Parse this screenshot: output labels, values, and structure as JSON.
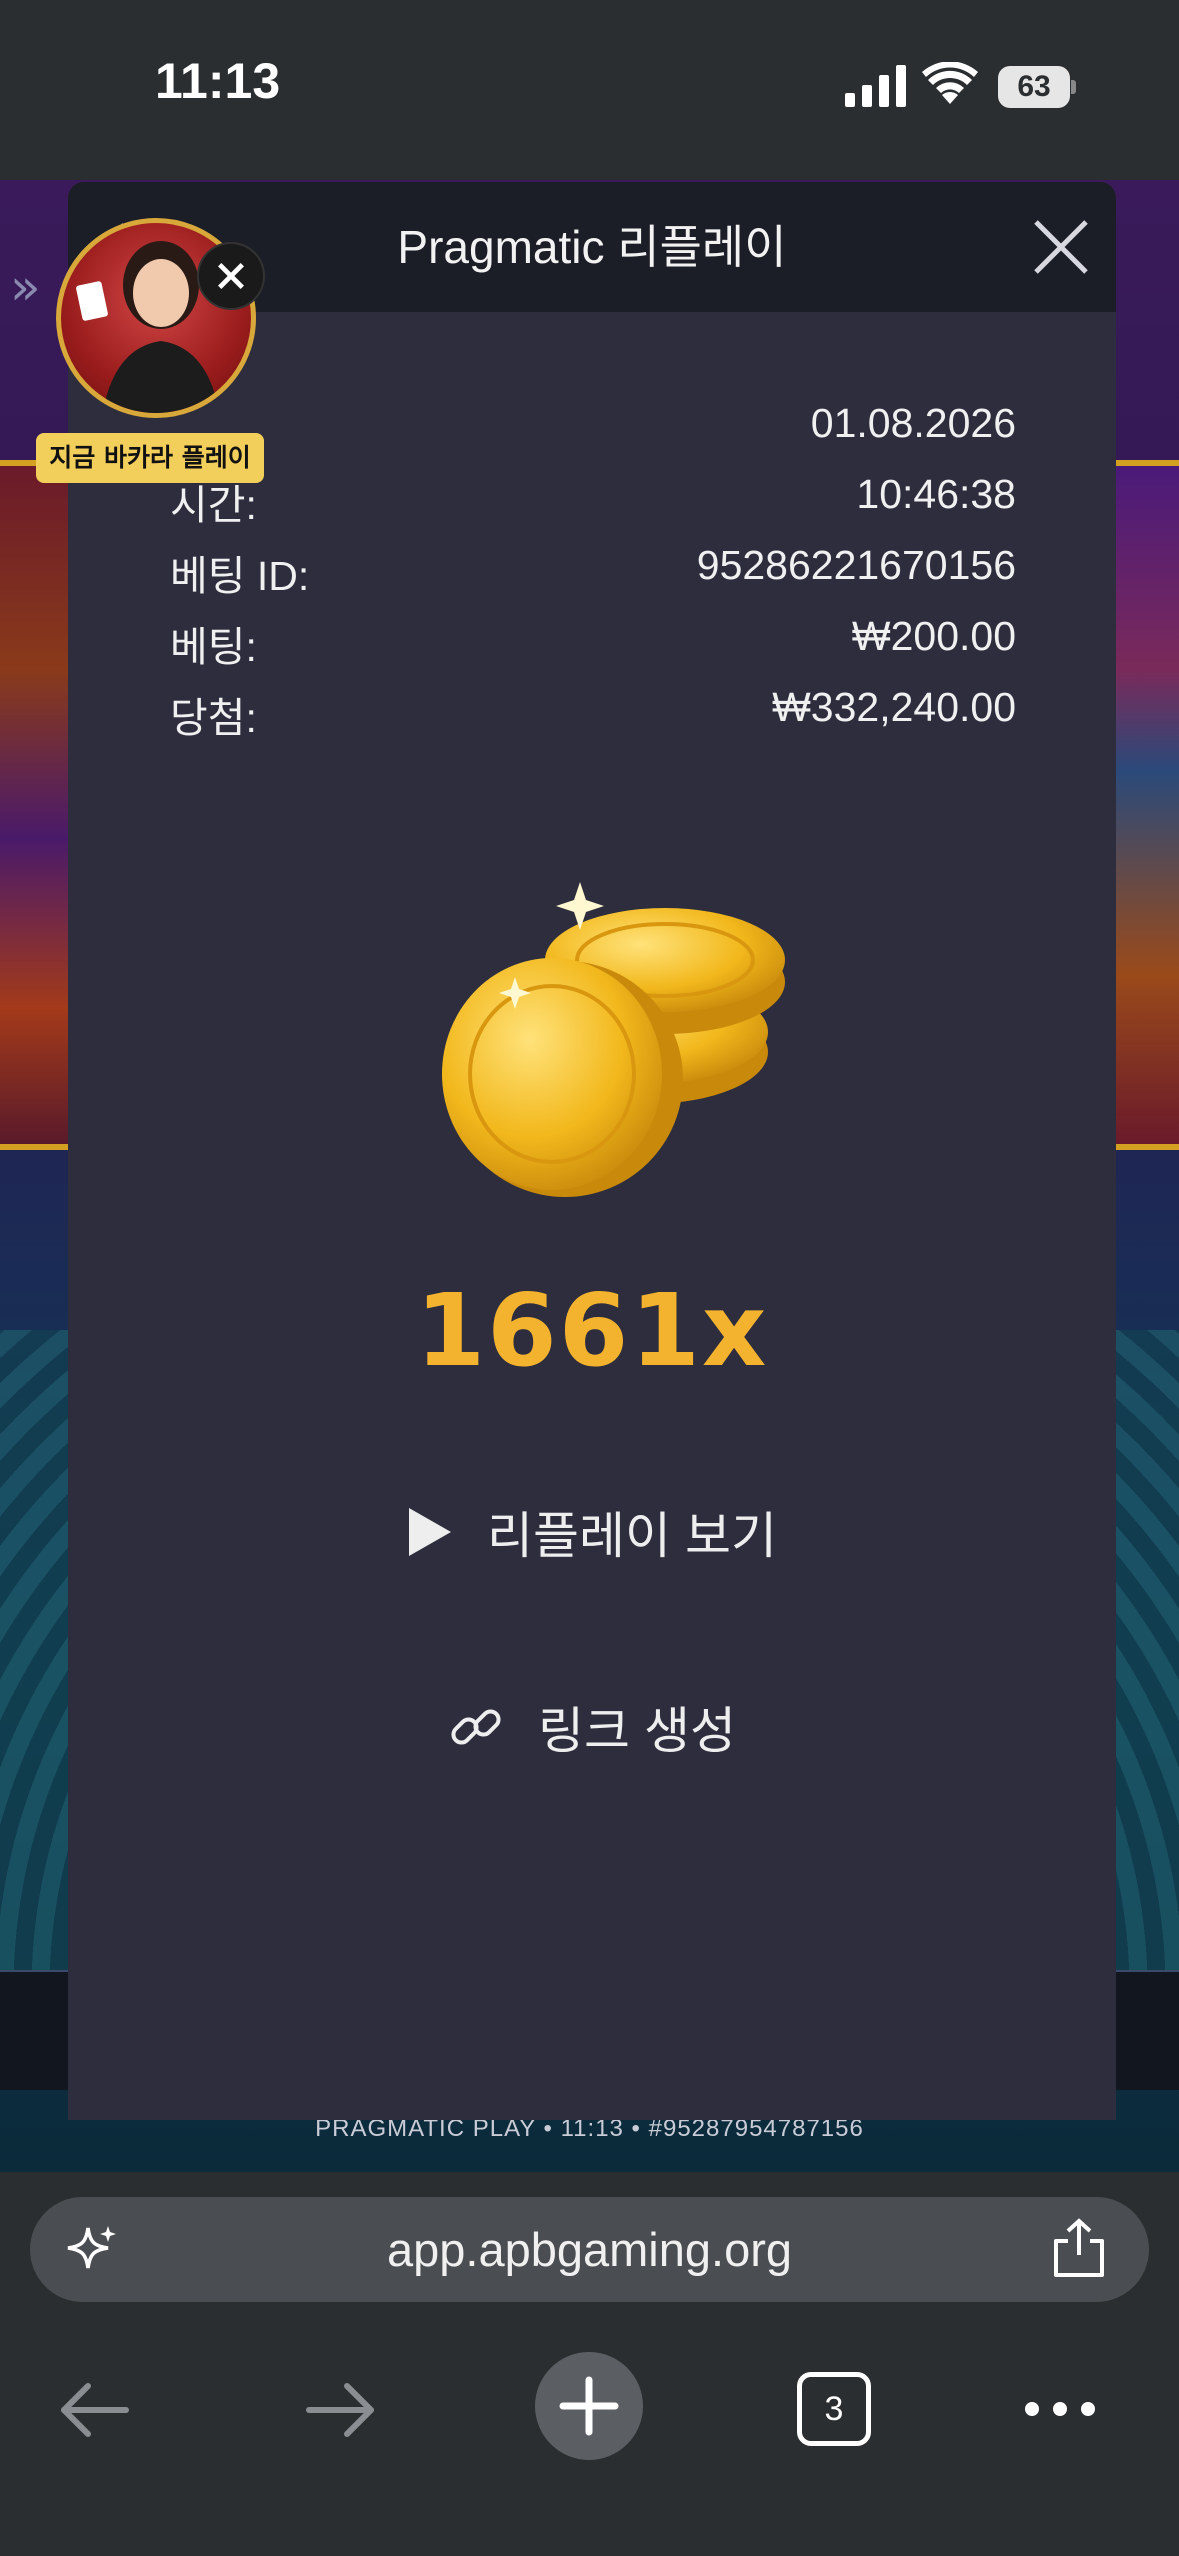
{
  "status_bar": {
    "time": "11:13",
    "battery": "63"
  },
  "game": {
    "footer_text": "PRAGMATIC PLAY • 11:13 • #95287954787156"
  },
  "promo": {
    "label": "지금 바카라 플레이"
  },
  "modal": {
    "title": "Pragmatic 리플레이",
    "info": [
      {
        "label": "",
        "value": "01.08.2026"
      },
      {
        "label": "시간:",
        "value": "10:46:38"
      },
      {
        "label": "베팅 ID:",
        "value": "95286221670156"
      },
      {
        "label": "베팅:",
        "value": "₩200.00"
      },
      {
        "label": "당첨:",
        "value": "₩332,240.00"
      }
    ],
    "multiplier": "1661x",
    "replay_label": "리플레이 보기",
    "link_label": "링크 생성"
  },
  "browser": {
    "url": "app.apbgaming.org",
    "tab_count": "3"
  },
  "colors": {
    "modal_bg": "#2d2d3e",
    "header_bg": "#1c1e27",
    "accent_gold": "#f4b32e"
  }
}
